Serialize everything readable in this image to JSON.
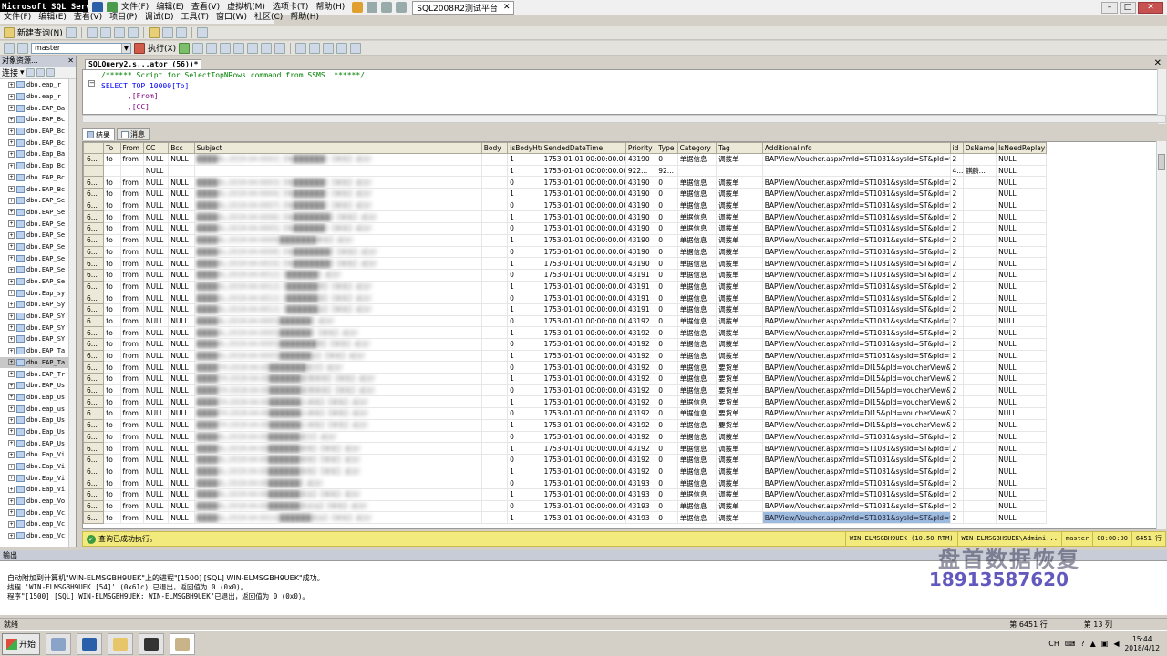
{
  "app_title": "Microsoft SQL Server Management Studio",
  "menus": [
    "文件(F)",
    "编辑(E)",
    "查看(V)",
    "项目(P)",
    "调试(D)",
    "工具(T)",
    "窗口(W)",
    "社区(C)",
    "帮助(H)"
  ],
  "top_menus": [
    "文件(F)",
    "编辑(E)",
    "查看(V)",
    "虚拟机(M)",
    "选项卡(T)",
    "帮助(H)"
  ],
  "vm_tab": "SQL2008R2测试平台",
  "toolbar": {
    "new_query": "新建查询(N)",
    "database": "master",
    "execute": "执行(X)"
  },
  "object_explorer": {
    "title": "对象资源...",
    "connect": "连接",
    "nodes": [
      "dbo.eap_r",
      "dbo.eap_r",
      "dbo.EAP_Ba",
      "dbo.EAP_Bc",
      "dbo.EAP_Bc",
      "dbo.EAP_Bc",
      "dbo.Eap_Ba",
      "dbo.Eap_Bc",
      "dbo.EAP_Bc",
      "dbo.EAP_Bc",
      "dbo.EAP_Se",
      "dbo.EAP_Se",
      "dbo.EAP_Se",
      "dbo.EAP_Se",
      "dbo.EAP_Se",
      "dbo.EAP_Se",
      "dbo.EAP_Se",
      "dbo.EAP_Se",
      "dbo.Eap_sy",
      "dbo.EAP_Sy",
      "dbo.EAP_SY",
      "dbo.EAP_SY",
      "dbo.EAP_SY",
      "dbo.EAP_Ta",
      "dbo.EAP_Ta",
      "dbo.EAP_Tr",
      "dbo.EAP_Us",
      "dbo.Eap_Us",
      "dbo.eap_us",
      "dbo.Eap_Us",
      "dbo.Eap_Us",
      "dbo.EAP_Us",
      "dbo.Eap_Vi",
      "dbo.Eap_Vi",
      "dbo.Eap_Vi",
      "dbo.Eap_Vi",
      "dbo.eap_Vo",
      "dbo.eap_Vc",
      "dbo.eap_Vc",
      "dbo.eap_Vc"
    ],
    "selected_index": 24
  },
  "query_tab": "SQLQuery2.s...ator (56))*",
  "editor_lines": [
    {
      "cls": "cmt",
      "text": "/****** Script for SelectTopNRows command from SSMS  ******/"
    },
    {
      "cls": "kw",
      "text": "SELECT TOP 10000[To]"
    },
    {
      "cls": "idf",
      "text": "      ,[From]"
    },
    {
      "cls": "idf",
      "text": "      ,[CC]"
    },
    {
      "cls": "idf",
      "text": "      ,[Bcc]"
    }
  ],
  "result_tabs": [
    "结果",
    "消息"
  ],
  "columns": [
    "",
    "To",
    "From",
    "CC",
    "Bcc",
    "Subject",
    "Body",
    "IsBodyHtml",
    "SendedDateTime",
    "Priority",
    "Type",
    "Category",
    "Tag",
    "AdditionalInfo",
    "id",
    "DsName",
    "IsNeedReplay"
  ],
  "rows": [
    [
      "6...",
      "to",
      "from",
      "NULL",
      "NULL",
      "████AL-2018-04-0002]【电██████】【审批】成功!",
      "",
      "1",
      "1753-01-01 00:00:00.000",
      "43190",
      "0",
      "单据信息",
      "调拨单",
      "BAPView/Voucher.aspx?mId=ST1031&sysId=ST&pId=vou...",
      "2",
      "",
      "NULL"
    ],
    [
      "",
      "",
      "",
      "NULL",
      "",
      "",
      "",
      "1",
      "1753-01-01 00:00:00.000",
      "922...",
      "92...",
      "",
      "",
      "",
      "4...",
      "麒麟...",
      "NULL"
    ],
    [
      "6...",
      "to",
      "from",
      "NULL",
      "NULL",
      "████AL-2018-04-0003]【电██████】【审批】成功!",
      "",
      "0",
      "1753-01-01 00:00:00.000",
      "43190",
      "0",
      "单据信息",
      "调拨单",
      "BAPView/Voucher.aspx?mId=ST1031&sysId=ST&pId=vou...",
      "2",
      "",
      "NULL"
    ],
    [
      "6...",
      "to",
      "from",
      "NULL",
      "NULL",
      "████AL-2018-04-0004]【电██████】【审批】成功!",
      "",
      "1",
      "1753-01-01 00:00:00.000",
      "43190",
      "0",
      "单据信息",
      "调拨单",
      "BAPView/Voucher.aspx?mId=ST1031&sysId=ST&pId=vou...",
      "2",
      "",
      "NULL"
    ],
    [
      "6...",
      "to",
      "from",
      "NULL",
      "NULL",
      "████AL-2018-04-0007]【电██████】【审批】成功!",
      "",
      "0",
      "1753-01-01 00:00:00.000",
      "43190",
      "0",
      "单据信息",
      "调拨单",
      "BAPView/Voucher.aspx?mId=ST1031&sysId=ST&pId=vou...",
      "2",
      "",
      "NULL"
    ],
    [
      "6...",
      "to",
      "from",
      "NULL",
      "NULL",
      "████AL-2018-04-0006]【电███████】【审批】成功!",
      "",
      "1",
      "1753-01-01 00:00:00.000",
      "43190",
      "0",
      "单据信息",
      "调拨单",
      "BAPView/Voucher.aspx?mId=ST1031&sysId=ST&pId=vou...",
      "2",
      "",
      "NULL"
    ],
    [
      "6...",
      "to",
      "from",
      "NULL",
      "NULL",
      "████AL-2018-04-0005]【电██████】【审批】成功!",
      "",
      "0",
      "1753-01-01 00:00:00.000",
      "43190",
      "0",
      "单据信息",
      "调拨单",
      "BAPView/Voucher.aspx?mId=ST1031&sysId=ST&pId=vou...",
      "2",
      "",
      "NULL"
    ],
    [
      "6...",
      "to",
      "from",
      "NULL",
      "NULL",
      "████AL-2018-04-0009]███████审批】成功!",
      "",
      "1",
      "1753-01-01 00:00:00.000",
      "43190",
      "0",
      "单据信息",
      "调拨单",
      "BAPView/Voucher.aspx?mId=ST1031&sysId=ST&pId=vou...",
      "2",
      "",
      "NULL"
    ],
    [
      "6...",
      "to",
      "from",
      "NULL",
      "NULL",
      "████AL-2018-04-0008]【电███████】【审批】成功!",
      "",
      "0",
      "1753-01-01 00:00:00.000",
      "43190",
      "0",
      "单据信息",
      "调拨单",
      "BAPView/Voucher.aspx?mId=ST1031&sysId=ST&pId=vou...",
      "2",
      "",
      "NULL"
    ],
    [
      "6...",
      "to",
      "from",
      "NULL",
      "NULL",
      "████AL-2018-04-0010]【电███████】【审批】成功!",
      "",
      "1",
      "1753-01-01 00:00:00.000",
      "43190",
      "0",
      "单据信息",
      "调拨单",
      "BAPView/Voucher.aspx?mId=ST1031&sysId=ST&pId=vou...",
      "2",
      "",
      "NULL"
    ],
    [
      "6...",
      "to",
      "from",
      "NULL",
      "NULL",
      "████AL-2018-04-0012]【██████】成功!",
      "",
      "0",
      "1753-01-01 00:00:00.000",
      "43191",
      "0",
      "单据信息",
      "调拨单",
      "BAPView/Voucher.aspx?mId=ST1031&sysId=ST&pId=vou...",
      "2",
      "",
      "NULL"
    ],
    [
      "6...",
      "to",
      "from",
      "NULL",
      "NULL",
      "████AL-2018-04-0012]【██████用】【审批】成功!",
      "",
      "1",
      "1753-01-01 00:00:00.000",
      "43191",
      "0",
      "单据信息",
      "调拨单",
      "BAPView/Voucher.aspx?mId=ST1031&sysId=ST&pId=vou...",
      "2",
      "",
      "NULL"
    ],
    [
      "6...",
      "to",
      "from",
      "NULL",
      "NULL",
      "████AL-2018-04-0012]【██████用】【审批】成功!",
      "",
      "0",
      "1753-01-01 00:00:00.000",
      "43191",
      "0",
      "单据信息",
      "调拨单",
      "BAPView/Voucher.aspx?mId=ST1031&sysId=ST&pId=vou...",
      "2",
      "",
      "NULL"
    ],
    [
      "6...",
      "to",
      "from",
      "NULL",
      "NULL",
      "████AL-2018-04-0012]【██████店】【审批】成功!",
      "",
      "1",
      "1753-01-01 00:00:00.000",
      "43191",
      "0",
      "单据信息",
      "调拨单",
      "BAPView/Voucher.aspx?mId=ST1031&sysId=ST&pId=vou...",
      "2",
      "",
      "NULL"
    ],
    [
      "6...",
      "to",
      "from",
      "NULL",
      "NULL",
      "████AL-2018-04-0005]██████】成功!",
      "",
      "0",
      "1753-01-01 00:00:00.000",
      "43192",
      "0",
      "单据信息",
      "调拨单",
      "BAPView/Voucher.aspx?mId=ST1031&sysId=ST&pId=vou...",
      "2",
      "",
      "NULL"
    ],
    [
      "6...",
      "to",
      "from",
      "NULL",
      "NULL",
      "████AL-2018-04-0005]██████】【审批】成功!",
      "",
      "1",
      "1753-01-01 00:00:00.000",
      "43192",
      "0",
      "单据信息",
      "调拨单",
      "BAPView/Voucher.aspx?mId=ST1031&sysId=ST&pId=vou...",
      "2",
      "",
      "NULL"
    ],
    [
      "6...",
      "to",
      "from",
      "NULL",
      "NULL",
      "████AL-2018-04-0005]███████用】【审批】成功!",
      "",
      "0",
      "1753-01-01 00:00:00.000",
      "43192",
      "0",
      "单据信息",
      "调拨单",
      "BAPView/Voucher.aspx?mId=ST1031&sysId=ST&pId=vou...",
      "2",
      "",
      "NULL"
    ],
    [
      "6...",
      "to",
      "from",
      "NULL",
      "NULL",
      "████AL-2018-04-0005]██████店】【审批】成功!",
      "",
      "1",
      "1753-01-01 00:00:00.000",
      "43192",
      "0",
      "单据信息",
      "调拨单",
      "BAPView/Voucher.aspx?mId=ST1031&sysId=ST&pId=vou...",
      "2",
      "",
      "NULL"
    ],
    [
      "6...",
      "to",
      "from",
      "NULL",
      "NULL",
      "████YH-2018-04-00███████提交】成功!",
      "",
      "0",
      "1753-01-01 00:00:00.000",
      "43192",
      "0",
      "单据信息",
      "要货单",
      "BAPView/Voucher.aspx?mId=DI15&pId=voucherView&sysI...",
      "2",
      "",
      "NULL"
    ],
    [
      "6...",
      "to",
      "from",
      "NULL",
      "NULL",
      "████YH-2018-04-00██████管理审核】【审批】成功!",
      "",
      "1",
      "1753-01-01 00:00:00.000",
      "43192",
      "0",
      "单据信息",
      "要货单",
      "BAPView/Voucher.aspx?mId=DI15&pId=voucherView&sysI...",
      "2",
      "",
      "NULL"
    ],
    [
      "6...",
      "to",
      "from",
      "NULL",
      "NULL",
      "████YH-2018-04-00██████管理审核】【审批】成功!",
      "",
      "0",
      "1753-01-01 00:00:00.000",
      "43192",
      "0",
      "单据信息",
      "要货单",
      "BAPView/Voucher.aspx?mId=DI15&pId=voucherView&sysI...",
      "2",
      "",
      "NULL"
    ],
    [
      "6...",
      "to",
      "from",
      "NULL",
      "NULL",
      "████YH-2018-04-00██████人审批】【审批】成功!",
      "",
      "1",
      "1753-01-01 00:00:00.000",
      "43192",
      "0",
      "单据信息",
      "要货单",
      "BAPView/Voucher.aspx?mId=DI15&pId=voucherView&sysI...",
      "2",
      "",
      "NULL"
    ],
    [
      "6...",
      "to",
      "from",
      "NULL",
      "NULL",
      "████YH-2018-04-00██████人审批】【审批】成功!",
      "",
      "0",
      "1753-01-01 00:00:00.000",
      "43192",
      "0",
      "单据信息",
      "要货单",
      "BAPView/Voucher.aspx?mId=DI15&pId=voucherView&sysI...",
      "2",
      "",
      "NULL"
    ],
    [
      "6...",
      "to",
      "from",
      "NULL",
      "NULL",
      "████YH-2018-04-00██████人审批】【审批】成功!",
      "",
      "1",
      "1753-01-01 00:00:00.000",
      "43192",
      "0",
      "单据信息",
      "要货单",
      "BAPView/Voucher.aspx?mId=DI15&pId=voucherView&sysI...",
      "2",
      "",
      "NULL"
    ],
    [
      "6...",
      "to",
      "from",
      "NULL",
      "NULL",
      "████AL-2018-04-00██████提交】成功!",
      "",
      "0",
      "1753-01-01 00:00:00.000",
      "43192",
      "0",
      "单据信息",
      "调拨单",
      "BAPView/Voucher.aspx?mId=ST1031&sysId=ST&pId=vou...",
      "2",
      "",
      "NULL"
    ],
    [
      "6...",
      "to",
      "from",
      "NULL",
      "NULL",
      "████AL-2018-04-00██████审核】【审批】成功!",
      "",
      "1",
      "1753-01-01 00:00:00.000",
      "43192",
      "0",
      "单据信息",
      "调拨单",
      "BAPView/Voucher.aspx?mId=ST1031&sysId=ST&pId=vou...",
      "2",
      "",
      "NULL"
    ],
    [
      "6...",
      "to",
      "from",
      "NULL",
      "NULL",
      "████AL-2018-04-00██████审核】【审批】成功!",
      "",
      "0",
      "1753-01-01 00:00:00.000",
      "43192",
      "0",
      "单据信息",
      "调拨单",
      "BAPView/Voucher.aspx?mId=ST1031&sysId=ST&pId=vou...",
      "2",
      "",
      "NULL"
    ],
    [
      "6...",
      "to",
      "from",
      "NULL",
      "NULL",
      "████AL-2018-04-00██████审核】【审批】成功!",
      "",
      "1",
      "1753-01-01 00:00:00.000",
      "43192",
      "0",
      "单据信息",
      "调拨单",
      "BAPView/Voucher.aspx?mId=ST1031&sysId=ST&pId=vou...",
      "2",
      "",
      "NULL"
    ],
    [
      "6...",
      "to",
      "from",
      "NULL",
      "NULL",
      "████AL-2018-04-00██████】成功!",
      "",
      "0",
      "1753-01-01 00:00:00.000",
      "43193",
      "0",
      "单据信息",
      "调拨单",
      "BAPView/Voucher.aspx?mId=ST1031&sysId=ST&pId=vou...",
      "2",
      "",
      "NULL"
    ],
    [
      "6...",
      "to",
      "from",
      "NULL",
      "NULL",
      "████AL-2018-04-00██████房店】【审批】成功!",
      "",
      "1",
      "1753-01-01 00:00:00.000",
      "43193",
      "0",
      "单据信息",
      "调拨单",
      "BAPView/Voucher.aspx?mId=ST1031&sysId=ST&pId=vou...",
      "2",
      "",
      "NULL"
    ],
    [
      "6...",
      "to",
      "from",
      "NULL",
      "NULL",
      "████AL-2018-04-00██████房店站】【审批】成功!",
      "",
      "0",
      "1753-01-01 00:00:00.000",
      "43193",
      "0",
      "单据信息",
      "调拨单",
      "BAPView/Voucher.aspx?mId=ST1031&sysId=ST&pId=vou...",
      "2",
      "",
      "NULL"
    ],
    [
      "6...",
      "to",
      "from",
      "NULL",
      "NULL",
      "████AL-2018-04-0014]██████房店】【审批】成功!",
      "",
      "1",
      "1753-01-01 00:00:00.000",
      "43193",
      "0",
      "单据信息",
      "调拨单",
      "BAPView/Voucher.aspx?mId=ST1031&sysId=ST&pId=vou...",
      "2",
      "",
      "NULL"
    ]
  ],
  "status": {
    "message": "查询已成功执行。",
    "server": "WIN-ELMSGBH9UEK (10.50 RTM)",
    "user": "WIN-ELMSGBH9UEK\\Admini...",
    "db": "master",
    "time": "00:00:00",
    "rows": "6451 行"
  },
  "output": {
    "title": "输出",
    "lines": [
      "自动附加到计算机\"WIN-ELMSGBH9UEK\"上的进程\"[1500] [SQL] WIN-ELMSGBH9UEK\"成功。",
      "线程 'WIN-ELMSGBH9UEK [54]' (0x61c) 已退出，返回值为 0 (0x0)。",
      "程序\"[1500] [SQL] WIN-ELMSGBH9UEK: WIN-ELMSGBH9UEK\"已退出，返回值为 0 (0x0)。"
    ]
  },
  "watermark": {
    "title": "盘首数据恢复",
    "phone": "18913587620"
  },
  "bottom_status": {
    "ready": "就绪",
    "row": "第 6451 行",
    "col": "第 13 列"
  },
  "taskbar": {
    "start": "开始",
    "lang": "CH",
    "time": "15:44",
    "date": "2018/4/12"
  }
}
